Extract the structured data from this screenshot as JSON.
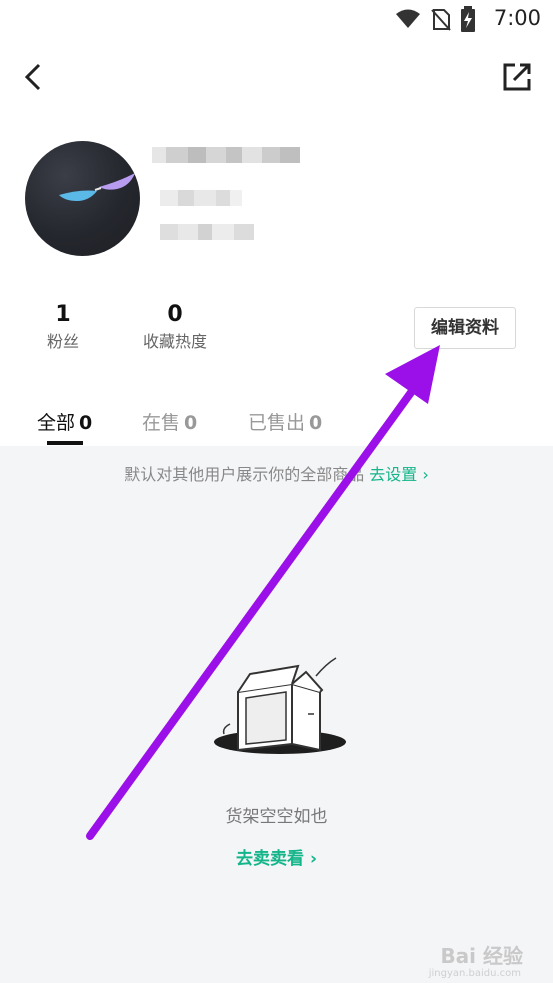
{
  "status_bar": {
    "time": "7:00",
    "icons": [
      "wifi-icon",
      "no-sim-icon",
      "battery-charging-icon"
    ]
  },
  "header": {
    "back_icon": "chevron-left-icon",
    "share_icon": "external-share-icon"
  },
  "profile": {
    "avatar": "sunglasses-avatar",
    "name_blurred": true,
    "id_blurred": true
  },
  "stats": [
    {
      "value": "1",
      "label": "粉丝"
    },
    {
      "value": "0",
      "label": "收藏热度"
    }
  ],
  "edit_profile_label": "编辑资料",
  "tabs": [
    {
      "label": "全部",
      "count": "0",
      "active": true
    },
    {
      "label": "在售",
      "count": "0",
      "active": false
    },
    {
      "label": "已售出",
      "count": "0",
      "active": false
    }
  ],
  "notice": {
    "text": "默认对其他用户展示你的全部商品",
    "link": "去设置 ›"
  },
  "empty_state": {
    "illustration": "empty-box-illustration",
    "text": "货架空空如也",
    "action": "去卖卖看 ›"
  },
  "colors": {
    "accent": "#14b58a",
    "annotation_arrow": "#9b10e8",
    "background_gray": "#f4f5f7"
  },
  "watermark": {
    "text": "Bai 经验",
    "sub": "jingyan.baidu.com"
  }
}
